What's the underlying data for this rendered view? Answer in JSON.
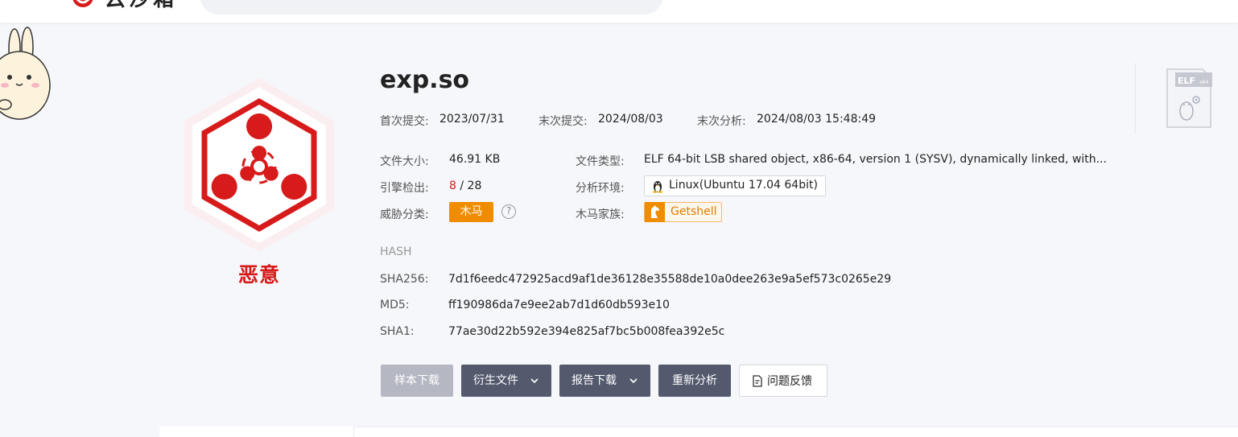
{
  "brand": {
    "logo_text": "云沙箱",
    "accent": "#d71a1a"
  },
  "search": {
    "placeholder": ""
  },
  "file": {
    "name": "exp.so",
    "verdict": "恶意",
    "first_submit_label": "首次提交:",
    "first_submit_value": "2023/07/31",
    "last_submit_label": "末次提交:",
    "last_submit_value": "2024/08/03",
    "last_analysis_label": "末次分析:",
    "last_analysis_value": "2024/08/03 15:48:49",
    "size_label": "文件大小:",
    "size_value": "46.91 KB",
    "type_label": "文件类型:",
    "type_value": "ELF 64-bit LSB shared object, x86-64, version 1 (SYSV), dynamically linked, with...",
    "engines_label": "引擎检出:",
    "engines_detected": "8",
    "engines_total": "/ 28",
    "env_label": "分析环境:",
    "env_value": "Linux(Ubuntu 17.04 64bit)",
    "threat_label": "威胁分类:",
    "threat_value": "木马",
    "family_label": "木马家族:",
    "family_value": "Getshell",
    "filetype_badge": "ELF",
    "filetype_badge_sub": "x64"
  },
  "hash": {
    "title": "HASH",
    "sha256_label": "SHA256:",
    "sha256": "7d1f6eedc472925acd9af1de36128e35588de10a0dee263e9a5ef573c0265e29",
    "md5_label": "MD5:",
    "md5": "ff190986da7e9ee2ab7d1d60db593e10",
    "sha1_label": "SHA1:",
    "sha1": "77ae30d22b592e394e825af7bc5b008fea392e5c"
  },
  "actions": {
    "download_sample": "样本下载",
    "derived_files": "衍生文件",
    "report_download": "报告下载",
    "reanalyze": "重新分析",
    "feedback": "问题反馈"
  },
  "icons": {
    "verdict": "biohazard-icon",
    "env": "linux-penguin-icon",
    "family": "trojan-horse-icon",
    "help": "question-circle-icon",
    "feedback": "edit-document-icon",
    "caret": "chevron-down-icon"
  }
}
